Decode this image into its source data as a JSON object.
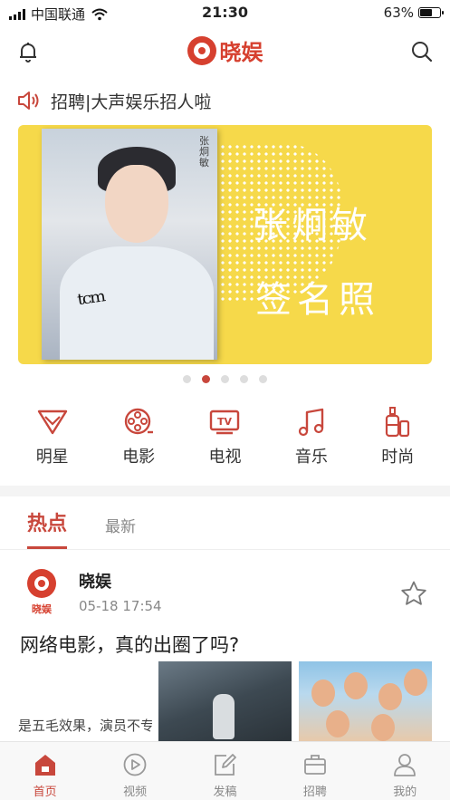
{
  "status_bar": {
    "carrier": "中国联通",
    "time": "21:30",
    "battery_pct": "63%",
    "battery_level": 0.63
  },
  "header": {
    "app_name": "晓娱",
    "left_icon": "bell-icon",
    "right_icon": "search-icon"
  },
  "notice": {
    "icon": "speaker-icon",
    "text": "招聘|大声娱乐招人啦"
  },
  "banner": {
    "title": "张炯敏",
    "subtitle": "签名照",
    "photo_label": "张炯敏",
    "signature": "ᵗᶜᵐ",
    "page_count": 5,
    "active_page": 2
  },
  "categories": [
    {
      "label": "明星",
      "icon": "diamond-icon"
    },
    {
      "label": "电影",
      "icon": "film-reel-icon"
    },
    {
      "label": "电视",
      "icon": "tv-icon"
    },
    {
      "label": "音乐",
      "icon": "music-note-icon"
    },
    {
      "label": "时尚",
      "icon": "perfume-icon"
    }
  ],
  "tabs": [
    {
      "label": "热点",
      "active": true
    },
    {
      "label": "最新",
      "active": false
    }
  ],
  "post": {
    "avatar_text": "晓娱",
    "author": "晓娱",
    "time": "05-18 17:54",
    "title": "网络电影，真的出圈了吗?",
    "snippet": "是五毛效果，演员不专"
  },
  "bottom_nav": [
    {
      "label": "首页",
      "icon": "home-icon",
      "active": true
    },
    {
      "label": "视频",
      "icon": "play-icon",
      "active": false
    },
    {
      "label": "发稿",
      "icon": "edit-icon",
      "active": false
    },
    {
      "label": "招聘",
      "icon": "briefcase-icon",
      "active": false
    },
    {
      "label": "我的",
      "icon": "profile-icon",
      "active": false
    }
  ],
  "colors": {
    "accent": "#c8473c",
    "banner_bg": "#f6d94a"
  }
}
